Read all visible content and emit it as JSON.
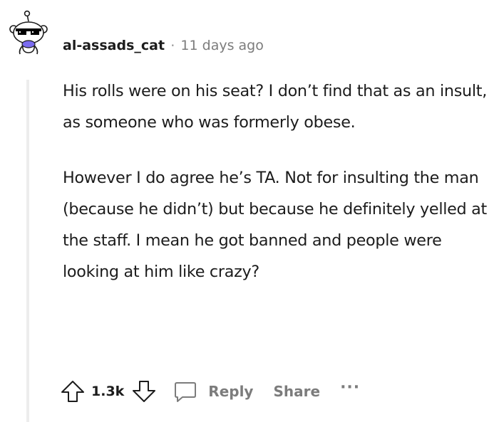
{
  "comment": {
    "username": "al-assads_cat",
    "separator": "·",
    "timestamp": "11 days ago",
    "paragraphs": [
      "His rolls were on his seat? I don’t find that as an insult, as someone who was formerly obese.",
      "However I do agree he’s TA. Not for insulting the man (because he didn’t) but because he definitely yelled at the staff. I mean he got banned and people were looking at him like crazy?"
    ]
  },
  "actions": {
    "vote_count": "1.3k",
    "reply_label": "Reply",
    "share_label": "Share",
    "more_label": "···"
  },
  "icons": {
    "avatar": "snoo-avatar-with-sunglasses",
    "upvote": "arrow-up-icon",
    "downvote": "arrow-down-icon",
    "reply": "speech-bubble-icon",
    "more": "ellipsis-icon"
  },
  "colors": {
    "text": "#1c1c1c",
    "meta": "#7c7c7c",
    "thread_line": "#ededed",
    "avatar_accent": "#7b6cf0"
  }
}
